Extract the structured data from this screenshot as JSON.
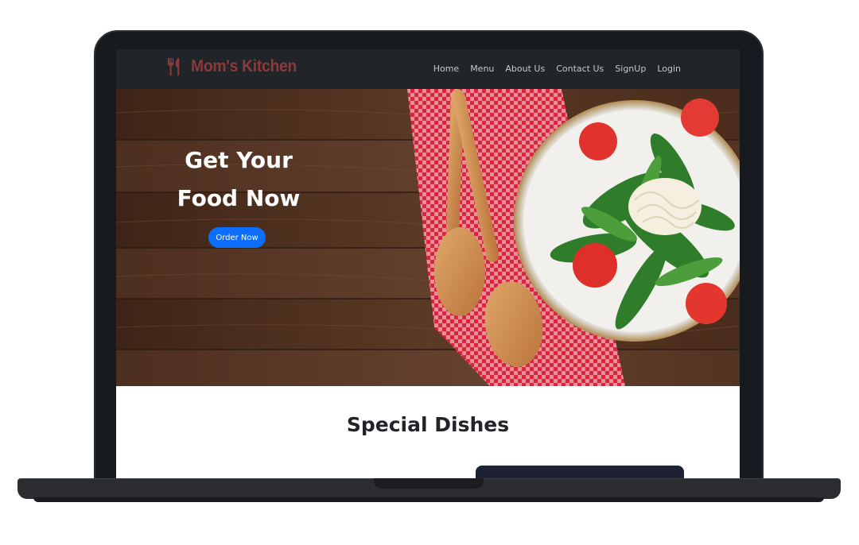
{
  "brand": {
    "name": "Mom's Kitchen",
    "icon": "fork-knife-icon",
    "color": "#8e3a3a"
  },
  "nav": {
    "items": [
      {
        "label": "Home"
      },
      {
        "label": "Menu"
      },
      {
        "label": "About Us"
      },
      {
        "label": "Contact Us"
      },
      {
        "label": "SignUp"
      },
      {
        "label": "Login"
      }
    ]
  },
  "hero": {
    "title_line1": "Get Your",
    "title_line2": "Food Now",
    "cta_label": "Order Now",
    "cta_color": "#0d6efd"
  },
  "section": {
    "title": "Special Dishes"
  }
}
